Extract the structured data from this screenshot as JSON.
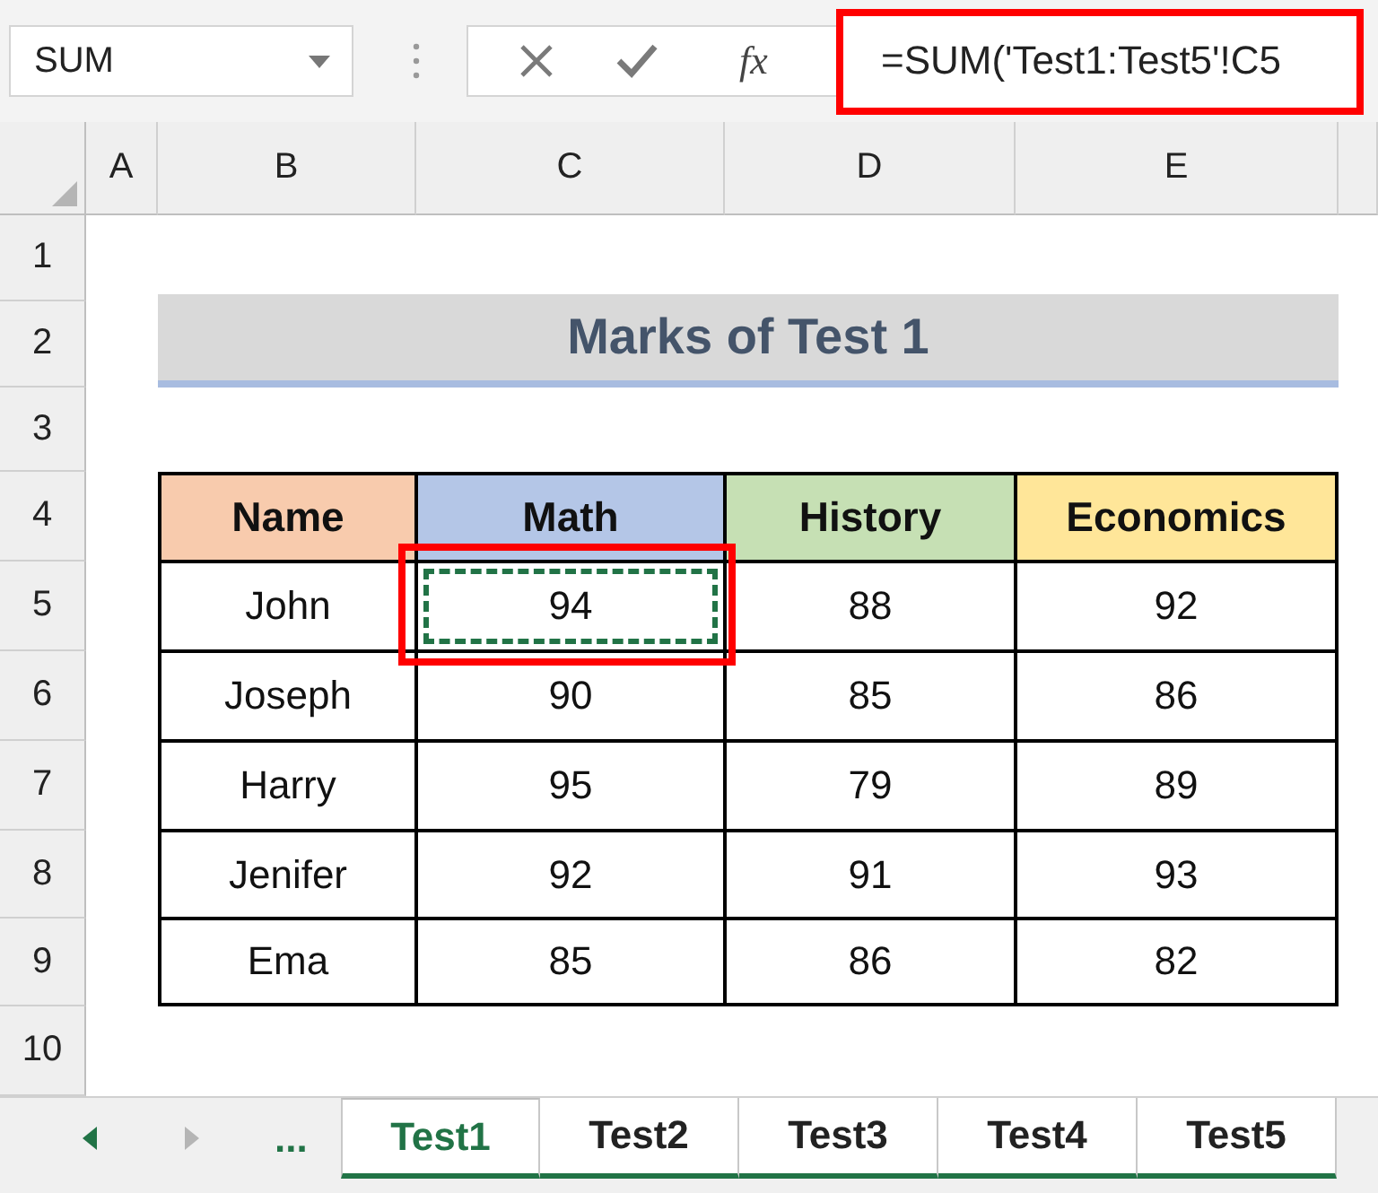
{
  "formula_bar": {
    "name_box": "SUM",
    "insert_function": "fx",
    "formula": "=SUM('Test1:Test5'!C5",
    "highlighted": true
  },
  "columns": [
    "A",
    "B",
    "C",
    "D",
    "E"
  ],
  "rows": [
    "1",
    "2",
    "3",
    "4",
    "5",
    "6",
    "7",
    "8",
    "9",
    "10"
  ],
  "title": "Marks of Test 1",
  "table": {
    "columns": [
      {
        "label": "Name",
        "color": "#f8cbad"
      },
      {
        "label": "Math",
        "color": "#b4c6e7"
      },
      {
        "label": "History",
        "color": "#c6e0b4"
      },
      {
        "label": "Economics",
        "color": "#ffe699"
      }
    ],
    "rows": [
      [
        {
          "text": "John",
          "selected": false,
          "highlighted": false
        },
        {
          "text": "94",
          "selected": true,
          "highlighted": true
        },
        {
          "text": "88",
          "selected": false,
          "highlighted": false
        },
        {
          "text": "92",
          "selected": false,
          "highlighted": false
        }
      ],
      [
        {
          "text": "Joseph",
          "selected": false,
          "highlighted": false
        },
        {
          "text": "90",
          "selected": false,
          "highlighted": false
        },
        {
          "text": "85",
          "selected": false,
          "highlighted": false
        },
        {
          "text": "86",
          "selected": false,
          "highlighted": false
        }
      ],
      [
        {
          "text": "Harry",
          "selected": false,
          "highlighted": false
        },
        {
          "text": "95",
          "selected": false,
          "highlighted": false
        },
        {
          "text": "79",
          "selected": false,
          "highlighted": false
        },
        {
          "text": "89",
          "selected": false,
          "highlighted": false
        }
      ],
      [
        {
          "text": "Jenifer",
          "selected": false,
          "highlighted": false
        },
        {
          "text": "92",
          "selected": false,
          "highlighted": false
        },
        {
          "text": "91",
          "selected": false,
          "highlighted": false
        },
        {
          "text": "93",
          "selected": false,
          "highlighted": false
        }
      ],
      [
        {
          "text": "Ema",
          "selected": false,
          "highlighted": false
        },
        {
          "text": "85",
          "selected": false,
          "highlighted": false
        },
        {
          "text": "86",
          "selected": false,
          "highlighted": false
        },
        {
          "text": "82",
          "selected": false,
          "highlighted": false
        }
      ]
    ]
  },
  "sheet_nav": {
    "more": "..."
  },
  "sheet_tabs": [
    {
      "label": "Test1",
      "selected": true
    },
    {
      "label": "Test2",
      "selected": false
    },
    {
      "label": "Test3",
      "selected": false
    },
    {
      "label": "Test4",
      "selected": false
    },
    {
      "label": "Test5",
      "selected": false
    }
  ]
}
